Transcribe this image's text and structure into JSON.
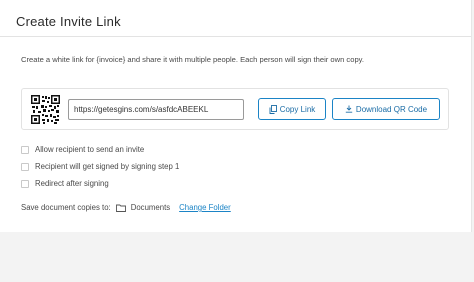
{
  "modal": {
    "title": "Create Invite Link",
    "description": "Create a white link for {invoice} and share it with multiple people. Each person will sign their own copy."
  },
  "link": {
    "url": "https://getesgins.com/s/asfdcABEEKL",
    "qr_icon": "qr-code-icon",
    "copy_label": "Copy Link",
    "copy_icon": "copy-icon",
    "download_label": "Download QR Code",
    "download_icon": "download-icon"
  },
  "options": [
    {
      "label": "Allow recipient to send an invite",
      "checked": false
    },
    {
      "label": "Recipient will get signed by signing step 1",
      "checked": false
    },
    {
      "label": "Redirect after signing",
      "checked": false
    }
  ],
  "save": {
    "prefix": "Save document copies to:",
    "folder_icon": "folder-icon",
    "folder_name": "Documents",
    "change_label": "Change Folder"
  },
  "colors": {
    "accent": "#1b84c6",
    "background": "#f3f3f3",
    "panel": "#ffffff"
  }
}
